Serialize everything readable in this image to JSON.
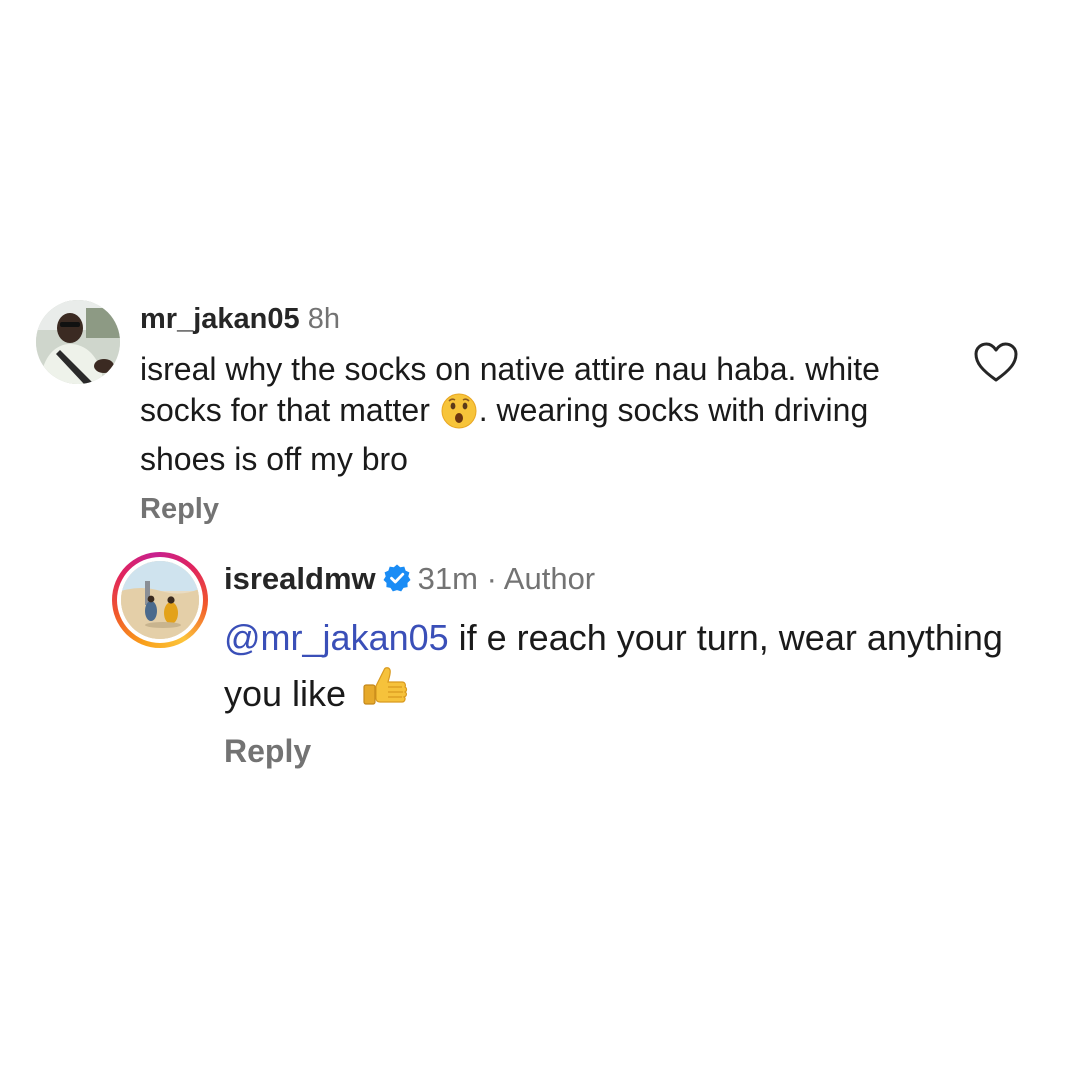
{
  "comments": [
    {
      "username": "mr_jakan05",
      "time": "8h",
      "text_part1": "isreal why the socks on native attire nau haba. white socks for that matter ",
      "emoji": "hushed-face",
      "text_part2": ". wearing socks with driving shoes is off my bro",
      "reply_label": "Reply",
      "like_icon": "heart-outline-icon"
    },
    {
      "username": "isrealdmw",
      "verified_icon": "verified-badge-icon",
      "time": "31m",
      "separator": "·",
      "role": "Author",
      "mention": "@mr_jakan05",
      "text": " if e reach your turn, wear anything you like ",
      "emoji": "thumbs-up",
      "reply_label": "Reply"
    }
  ],
  "colors": {
    "username": "#262626",
    "meta": "#737373",
    "mention": "#3a4fb8",
    "verified": "#1a8cf5"
  }
}
